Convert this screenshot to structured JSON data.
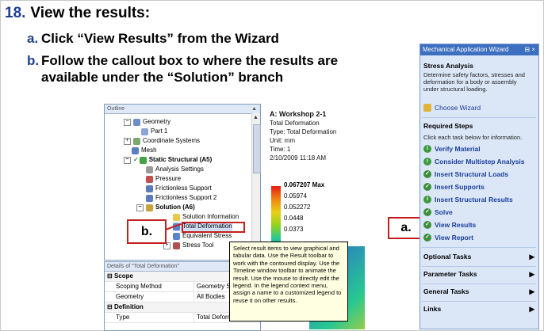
{
  "step": {
    "number": "18.",
    "title": "View the results:"
  },
  "instructions": {
    "a_letter": "a.",
    "a_text": "Click “View Results” from the Wizard",
    "b_letter": "b.",
    "b_text_1": "Follow the callout box to where the results are",
    "b_text_2": "available under the “Solution” branch"
  },
  "outline": {
    "title": "Outline",
    "pin": "⁵",
    "items": [
      {
        "label": "Geometry"
      },
      {
        "label": "Part 1"
      },
      {
        "label": "Coordinate Systems"
      },
      {
        "label": "Mesh"
      },
      {
        "label": "Static Structural (A5)"
      },
      {
        "label": "Analysis Settings"
      },
      {
        "label": "Pressure"
      },
      {
        "label": "Frictionless Support"
      },
      {
        "label": "Frictionless Support 2"
      },
      {
        "label": "Solution (A6)"
      },
      {
        "label": "Solution Information"
      },
      {
        "label": "Total Deformation"
      },
      {
        "label": "Equivalent Stress"
      },
      {
        "label": "Stress Tool"
      }
    ]
  },
  "details": {
    "title": "Details of \"Total Deformation\"",
    "rows": [
      {
        "group": "Scope"
      },
      {
        "label": "Scoping Method",
        "value": "Geometry Select"
      },
      {
        "label": "Geometry",
        "value": "All Bodies"
      },
      {
        "group": "Definition"
      },
      {
        "label": "Type",
        "value": "Total Deformation"
      }
    ]
  },
  "viewport": {
    "title": "A: Workshop 2-1",
    "lines": [
      "Total Deformation",
      "Type: Total Deformation",
      "Unit: mm",
      "Time: 1",
      "2/10/2009 11:18 AM"
    ],
    "legend": [
      "0.067207 Max",
      "0.05974",
      "0.052272",
      "0.0448",
      "0.0373"
    ]
  },
  "tooltip": {
    "text": "Select result items to view graphical and tabular data. Use the Result toolbar to work with the contoured display. Use the Timeline window toolbar to animate the result. Use the mouse to directly edit the legend. In the legend context menu, assign a name to a customized legend to reuse it on other results."
  },
  "callouts": {
    "b": "b.",
    "a": "a."
  },
  "wizard": {
    "title": "Mechanical Application Wizard",
    "title_ctl": "⊟ ×",
    "section1": "Stress Analysis",
    "desc": "Determine safety factors, stresses and deformation for a body or assembly under structural loading.",
    "choose": "Choose Wizard",
    "section2": "Required Steps",
    "instr": "Click each task below for information.",
    "steps": [
      "Verify Material",
      "Consider Multistep Analysis",
      "Insert Structural Loads",
      "Insert Supports",
      "Insert Structural Results",
      "Solve",
      "View Results",
      "View Report"
    ],
    "tails": [
      "Optional Tasks",
      "Parameter Tasks",
      "General Tasks",
      "Links"
    ]
  },
  "colors": {
    "accent": "#c41e1e",
    "wizard_title": "#3d6fc1",
    "step_number": "#1f3f8f"
  }
}
